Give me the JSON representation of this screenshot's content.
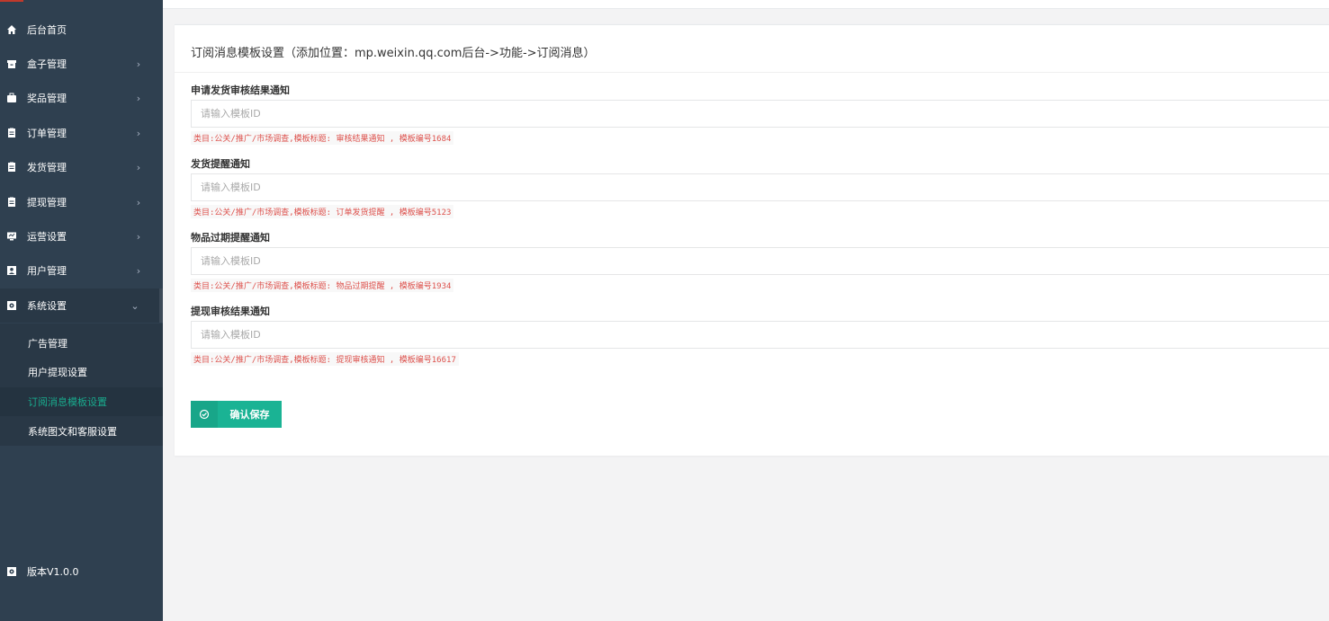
{
  "sidebar": {
    "items": [
      {
        "label": "后台首页",
        "icon": "home-icon",
        "has_children": false
      },
      {
        "label": "盒子管理",
        "icon": "box-icon",
        "has_children": true
      },
      {
        "label": "奖品管理",
        "icon": "gift-icon",
        "has_children": true
      },
      {
        "label": "订单管理",
        "icon": "order-icon",
        "has_children": true
      },
      {
        "label": "发货管理",
        "icon": "shipping-icon",
        "has_children": true
      },
      {
        "label": "提现管理",
        "icon": "withdraw-icon",
        "has_children": true
      },
      {
        "label": "运营设置",
        "icon": "operation-icon",
        "has_children": true
      },
      {
        "label": "用户管理",
        "icon": "user-icon",
        "has_children": true
      },
      {
        "label": "系统设置",
        "icon": "gear-icon",
        "has_children": true,
        "expanded": true
      }
    ],
    "sub_items": [
      {
        "label": "广告管理",
        "active": false
      },
      {
        "label": "用户提现设置",
        "active": false
      },
      {
        "label": "订阅消息模板设置",
        "active": true
      },
      {
        "label": "系统图文和客服设置",
        "active": false
      }
    ],
    "chevron_right": "›",
    "chevron_down": "⌄",
    "version": "版本V1.0.0"
  },
  "panel": {
    "title": "订阅消息模板设置（添加位置：mp.weixin.qq.com后台->功能->订阅消息）",
    "fields": [
      {
        "label": "申请发货审核结果通知",
        "placeholder": "请输入模板ID",
        "value": "",
        "hint": "类目:公关/推广/市场调查,模板标题: 审核结果通知 , 模板编号1684"
      },
      {
        "label": "发货提醒通知",
        "placeholder": "请输入模板ID",
        "value": "",
        "hint": "类目:公关/推广/市场调查,模板标题: 订单发货提醒 , 模板编号5123"
      },
      {
        "label": "物品过期提醒通知",
        "placeholder": "请输入模板ID",
        "value": "",
        "hint": "类目:公关/推广/市场调查,模板标题: 物品过期提醒 , 模板编号1934"
      },
      {
        "label": "提现审核结果通知",
        "placeholder": "请输入模板ID",
        "value": "",
        "hint": "类目:公关/推广/市场调查,模板标题: 提现审核通知 , 模板编号16617"
      }
    ],
    "save_label": "确认保存"
  },
  "colors": {
    "sidebar_bg": "#2f4050",
    "accent": "#1ab394",
    "active_text": "#19aa8d",
    "hint_text": "#dd514c"
  }
}
